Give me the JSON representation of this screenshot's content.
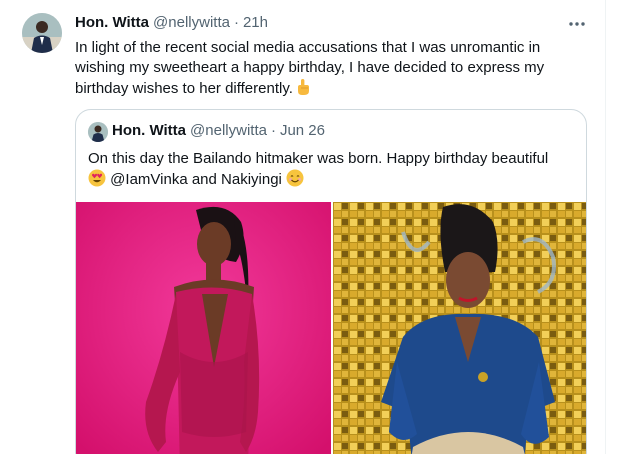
{
  "tweet": {
    "name": "Hon. Witta",
    "handle": "@nellywitta",
    "separator": "·",
    "time": "21h",
    "more_icon": "ellipsis-icon",
    "text": "In light of the recent social media accusations that I was unromantic in wishing my sweetheart a happy birthday, I have decided to express my birthday wishes to her differently.",
    "hand_icon": "pointing-up-emoji"
  },
  "quoted": {
    "name": "Hon. Witta",
    "handle": "@nellywitta",
    "separator": "·",
    "date": "Jun 26",
    "text_part1": "On this day the Bailando hitmaker was born. Happy birthday beautiful",
    "emoji1": "heart-eyes-emoji",
    "mention": "@IamVinka",
    "text_part2": "and Nakiyingi",
    "emoji2": "smiling-face-emoji"
  },
  "colors": {
    "text": "#0f1419",
    "secondary": "#536471",
    "border": "#cfd9de",
    "photo1_bg": "#e8177a",
    "photo2_bg": "#c9a227"
  }
}
